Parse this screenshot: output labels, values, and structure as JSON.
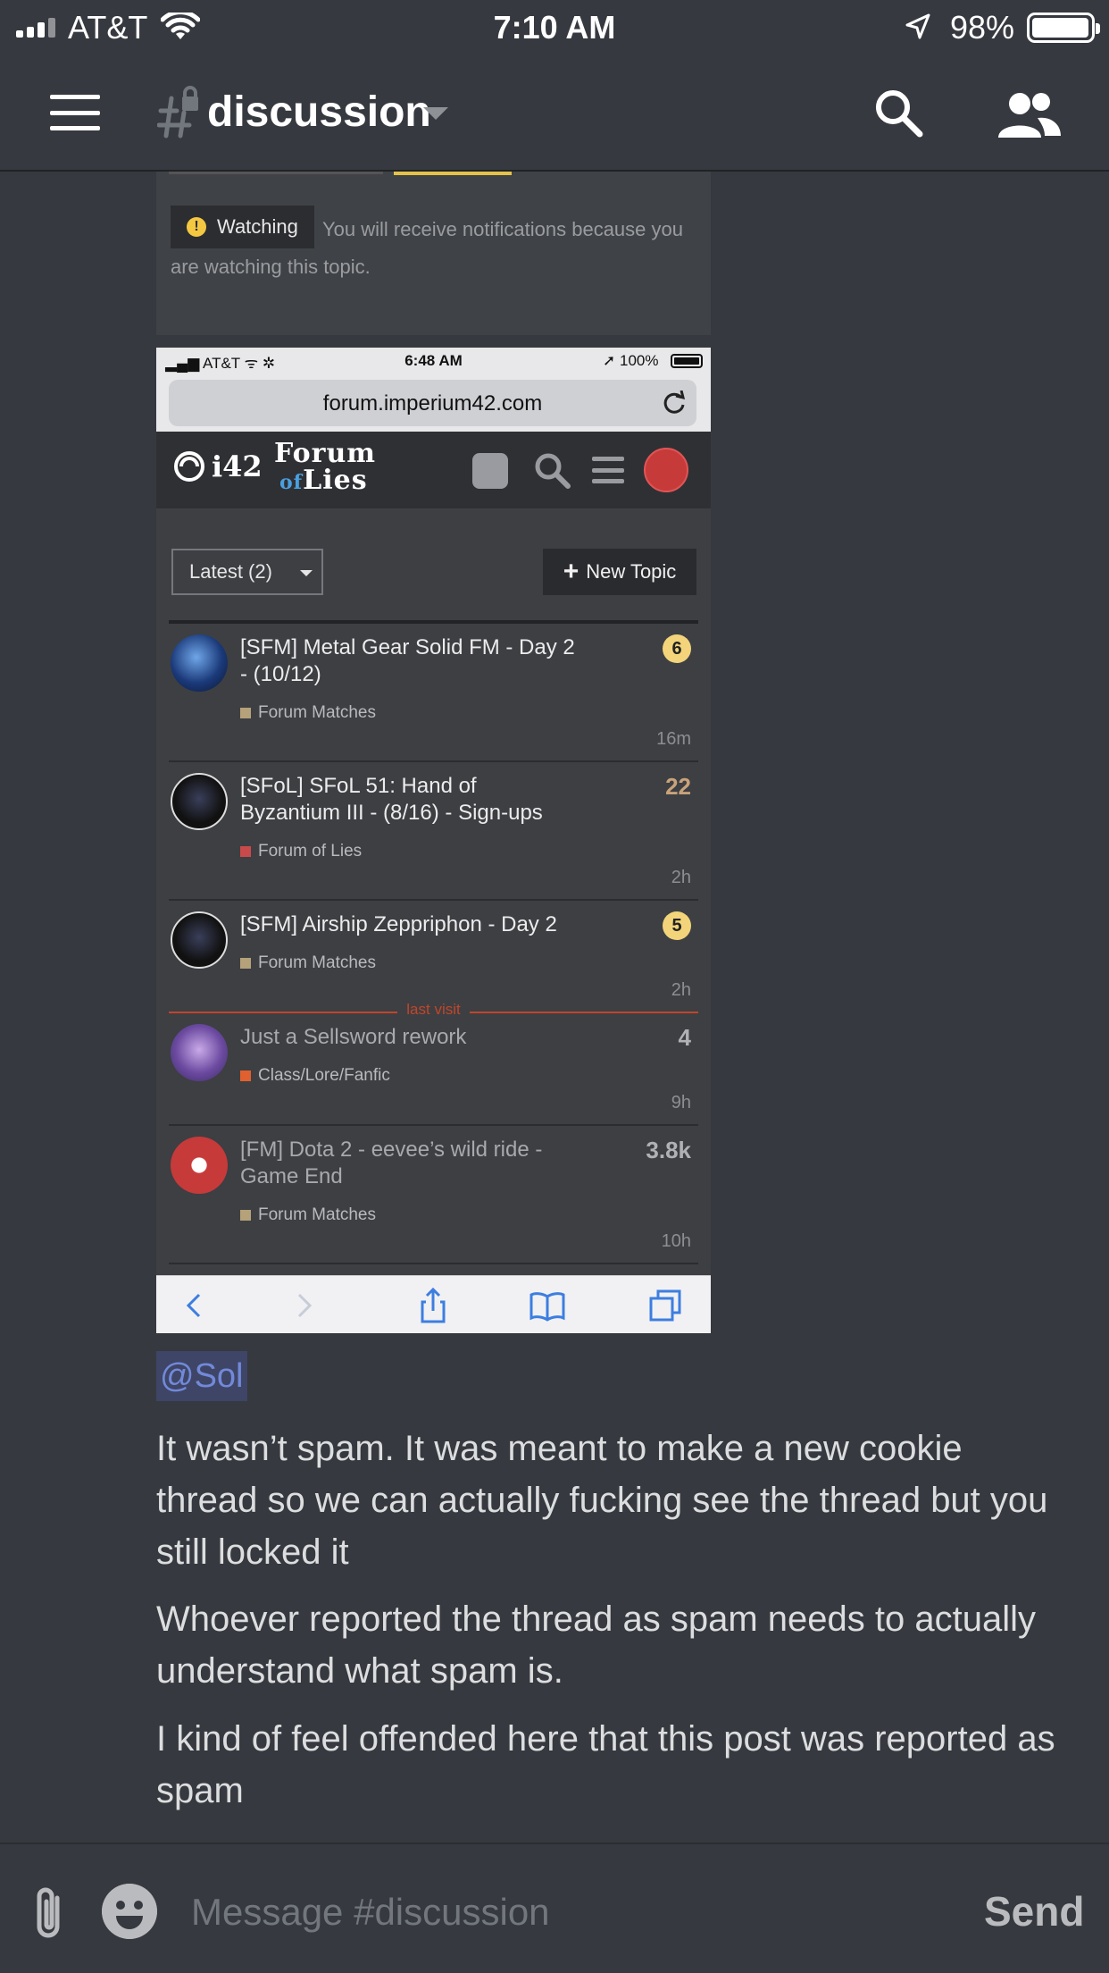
{
  "status_bar": {
    "carrier": "AT&T",
    "time": "7:10 AM",
    "battery": "98%",
    "battery_level": 0.98
  },
  "header": {
    "channel": "discussion",
    "icons": [
      "menu-icon",
      "locked-channel-icon",
      "search-icon",
      "members-icon"
    ]
  },
  "embed_top": {
    "watch_label": "Watching",
    "watch_text": "You will receive notifications because you are watching this topic."
  },
  "screenshot": {
    "status": {
      "carrier": "AT&T",
      "time": "6:48 AM",
      "battery": "100%"
    },
    "url": "forum.imperium42.com",
    "logo_i42": "i42",
    "logo_fol_line1": "Forum",
    "logo_fol_of": "of",
    "logo_fol_line2": "Lies",
    "latest_label": "Latest (2)",
    "new_topic_label": "New Topic",
    "last_visit_label": "last visit",
    "topics": [
      {
        "title": "[SFM] Metal Gear Solid FM - Day 2 - (10/12)",
        "category": "Forum Matches",
        "category_color": "#b5a27a",
        "badge": "6",
        "count": "",
        "age": "16m",
        "read": false
      },
      {
        "title": "[SFoL] SFoL 51: Hand of Byzantium III - (8/16) - Sign-ups",
        "category": "Forum of Lies",
        "category_color": "#c94a4a",
        "badge": "",
        "count": "22",
        "age": "2h",
        "read": false
      },
      {
        "title": "[SFM] Airship Zeppriphon - Day 2",
        "category": "Forum Matches",
        "category_color": "#b5a27a",
        "badge": "5",
        "count": "",
        "age": "2h",
        "read": false
      },
      {
        "title": "Just a Sellsword rework",
        "category": "Class/Lore/Fanfic",
        "category_color": "#e0612f",
        "badge": "",
        "count": "4",
        "age": "9h",
        "read": true
      },
      {
        "title": "[FM] Dota 2 - eevee’s wild ride - Game End",
        "category": "Forum Matches",
        "category_color": "#b5a27a",
        "badge": "",
        "count": "3.8k",
        "age": "10h",
        "read": true
      }
    ]
  },
  "messages": {
    "mention": "@Sol",
    "m1": "It wasn’t spam. It was meant to make a new cookie thread so we can actually fucking see the thread but you still locked it",
    "m2": "Whoever reported the thread as spam needs to actually understand what spam is.",
    "m3": "I kind of feel offended here that this post was reported as spam"
  },
  "composer": {
    "placeholder": "Message #discussion",
    "send_label": "Send"
  }
}
